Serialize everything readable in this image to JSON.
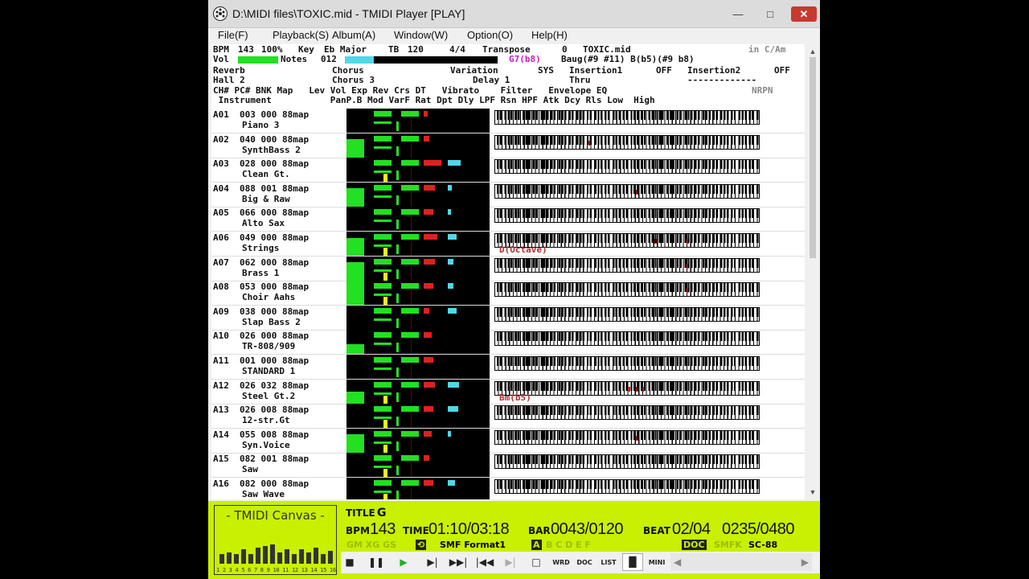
{
  "window": {
    "title": "D:\\MIDI files\\TOXIC.mid - TMIDI Player [PLAY]",
    "minimize": "—",
    "maximize": "□",
    "close": "✕"
  },
  "menu": [
    "File(F)",
    "Playback(S)",
    "Album(A)",
    "Window(W)",
    "Option(O)",
    "Help(H)"
  ],
  "status": {
    "bpm_label": "BPM",
    "bpm": "143",
    "percent": "100%",
    "key_label": "Key",
    "key": "Eb Major",
    "tb_label": "TB",
    "tb": "120",
    "time_sig": "4/4",
    "transpose_label": "Transpose",
    "transpose": "0",
    "filename": "TOXIC.mid",
    "key_hint": "in C/Am",
    "vol_label": "Vol",
    "notes_label": "Notes",
    "notes": "012",
    "chord_text": "G7(b8)",
    "chord_text2": "Baug(#9 #11) B(b5)(#9 b8)"
  },
  "effects": {
    "reverb_label": "Reverb",
    "reverb": "Hall 2",
    "chorus_label": "Chorus",
    "chorus": "Chorus 3",
    "variation_label": "Variation",
    "variation": "Delay 1",
    "sys_label": "SYS",
    "insertion1_label": "Insertion1",
    "insertion1_state": "OFF",
    "insertion1_value": "Thru",
    "insertion2_label": "Insertion2",
    "insertion2_state": "OFF",
    "insertion2_value": "-------------"
  },
  "headers": {
    "line1": "CH# PC# BNK Map   Lev Vol Exp Rev Crs DT   Vibrato    Filter   Envelope EQ",
    "nrpn": "NRPN",
    "line2": " Instrument           PanP.B Mod VarF Rat Dpt Dly LPF Rsn HPF Atk Dcy Rls Low  High"
  },
  "channels": [
    {
      "ch": "A01",
      "pc": "003",
      "bnk": "000",
      "map": "88map",
      "name": "Piano 3",
      "lev": 0.0,
      "note_text": ""
    },
    {
      "ch": "A02",
      "pc": "040",
      "bnk": "000",
      "map": "88map",
      "name": "SynthBass 2",
      "lev": 0.75,
      "note_text": ""
    },
    {
      "ch": "A03",
      "pc": "028",
      "bnk": "000",
      "map": "88map",
      "name": "Clean Gt.",
      "lev": 0.0,
      "note_text": ""
    },
    {
      "ch": "A04",
      "pc": "088",
      "bnk": "001",
      "map": "88map",
      "name": "Big & Raw",
      "lev": 0.75,
      "note_text": ""
    },
    {
      "ch": "A05",
      "pc": "066",
      "bnk": "000",
      "map": "88map",
      "name": "Alto Sax",
      "lev": 0.0,
      "note_text": ""
    },
    {
      "ch": "A06",
      "pc": "049",
      "bnk": "000",
      "map": "88map",
      "name": "Strings",
      "lev": 0.75,
      "note_text": "D(Octave)"
    },
    {
      "ch": "A07",
      "pc": "062",
      "bnk": "000",
      "map": "88map",
      "name": "Brass 1",
      "lev": 0.75,
      "note_text": ""
    },
    {
      "ch": "A08",
      "pc": "053",
      "bnk": "000",
      "map": "88map",
      "name": "Choir Aahs",
      "lev": 1.0,
      "note_text": ""
    },
    {
      "ch": "A09",
      "pc": "038",
      "bnk": "000",
      "map": "88map",
      "name": "Slap Bass 2",
      "lev": 0.0,
      "note_text": ""
    },
    {
      "ch": "A10",
      "pc": "026",
      "bnk": "000",
      "map": "88map",
      "name": "TR-808/909",
      "lev": 0.4,
      "note_text": ""
    },
    {
      "ch": "A11",
      "pc": "001",
      "bnk": "000",
      "map": "88map",
      "name": "STANDARD 1",
      "lev": 0.0,
      "note_text": ""
    },
    {
      "ch": "A12",
      "pc": "026",
      "bnk": "032",
      "map": "88map",
      "name": "Steel Gt.2",
      "lev": 0.5,
      "note_text": "Bm(b5)"
    },
    {
      "ch": "A13",
      "pc": "026",
      "bnk": "008",
      "map": "88map",
      "name": "12-str.Gt",
      "lev": 0.0,
      "note_text": ""
    },
    {
      "ch": "A14",
      "pc": "055",
      "bnk": "008",
      "map": "88map",
      "name": "Syn.Voice",
      "lev": 0.75,
      "note_text": ""
    },
    {
      "ch": "A15",
      "pc": "082",
      "bnk": "001",
      "map": "88map",
      "name": "Saw",
      "lev": 0.0,
      "note_text": ""
    },
    {
      "ch": "A16",
      "pc": "082",
      "bnk": "000",
      "map": "88map",
      "name": "Saw Wave",
      "lev": 0.0,
      "note_text": ""
    }
  ],
  "canvas": {
    "title": "- TMIDI Canvas -",
    "numbers": "1 2 3 4 5 6 7 8 9 10 11 12 13 14 15 16",
    "levels": [
      0.3,
      0.35,
      0.3,
      0.45,
      0.3,
      0.5,
      0.55,
      0.6,
      0.35,
      0.45,
      0.3,
      0.45,
      0.35,
      0.5,
      0.3,
      0.4
    ]
  },
  "lcd": {
    "title_label": "TITLE",
    "title": "G",
    "bpm_label": "BPM",
    "bpm": "143",
    "time_label": "TIME",
    "time": "01:10/03:18",
    "bar_label": "BAR",
    "bar": "0043/0120",
    "beat_label": "BEAT",
    "beat": "02/04",
    "tick": "0235/0480",
    "format": "SMF Format1",
    "mode_a": "A",
    "mode_dim": "B C D E F",
    "gm_dim": "GM XG GS",
    "doc_chip": "DOC",
    "dim2": "SMFK",
    "module": "SC-88"
  },
  "controls": {
    "stop": "■",
    "pause": "❚❚",
    "play": "▶",
    "step": "▶|",
    "next": "▶▶|",
    "prev": "|◀◀",
    "last": "▶|",
    "window_btn": "□",
    "wrd": "WRD",
    "doc": "DOC",
    "list": "LIST",
    "mini": "MINI"
  },
  "colors": {
    "lcd_bg": "#c8f000",
    "meter_green": "#22e022",
    "meter_red": "#e02020",
    "meter_cyan": "#4fd8e8",
    "meter_yellow": "#f0f020",
    "close_red": "#c7392e"
  }
}
